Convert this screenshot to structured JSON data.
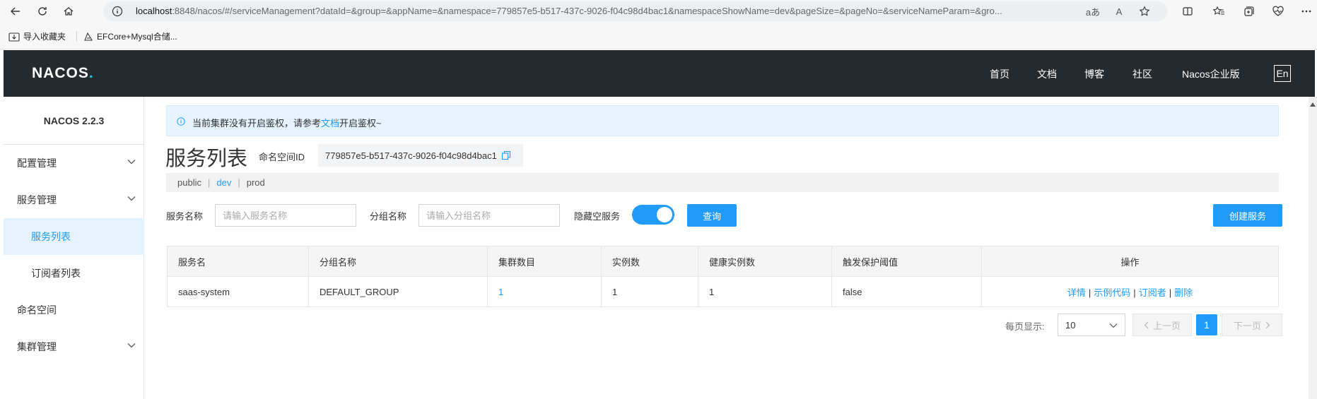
{
  "browser": {
    "url_host": "localhost",
    "url_rest": ":8848/nacos/#/serviceManagement?dataId=&group=&appName=&namespace=779857e5-b517-437c-9026-f04c98d4bac1&namespaceShowName=dev&pageSize=&pageNo=&serviceNameParam=&gro...",
    "read_aloud": "aあ",
    "text_size": "A",
    "bookmarks": [
      {
        "label": "导入收藏夹"
      },
      {
        "label": "EFCore+Mysql合储..."
      }
    ]
  },
  "header": {
    "logo_text": "NACOS",
    "logo_dot": ".",
    "nav": [
      "首页",
      "文档",
      "博客",
      "社区",
      "Nacos企业版"
    ],
    "lang_button": "En"
  },
  "sidebar": {
    "version": "NACOS 2.2.3",
    "items": [
      {
        "label": "配置管理"
      },
      {
        "label": "服务管理"
      },
      {
        "label": "服务列表"
      },
      {
        "label": "订阅者列表"
      },
      {
        "label": "命名空间"
      },
      {
        "label": "集群管理"
      }
    ]
  },
  "notice": {
    "text_before": "当前集群没有开启鉴权，请参考",
    "link": "文档",
    "text_after": "开启鉴权~"
  },
  "page": {
    "title": "服务列表",
    "namespace_label": "命名空间ID",
    "namespace_id": "779857e5-b517-437c-9026-f04c98d4bac1",
    "namespaces": [
      "public",
      "dev",
      "prod"
    ],
    "namespace_separator": "|",
    "current_namespace": "dev"
  },
  "filters": {
    "service_name_label": "服务名称",
    "service_name_placeholder": "请输入服务名称",
    "group_name_label": "分组名称",
    "group_name_placeholder": "请输入分组名称",
    "hide_empty_label": "隐藏空服务",
    "hide_empty_on": true,
    "query_button": "查询",
    "create_button": "创建服务"
  },
  "table": {
    "columns": [
      "服务名",
      "分组名称",
      "集群数目",
      "实例数",
      "健康实例数",
      "触发保护阈值",
      "操作"
    ],
    "rows": [
      {
        "service_name": "saas-system",
        "group": "DEFAULT_GROUP",
        "clusters": "1",
        "instances": "1",
        "healthy": "1",
        "threshold": "false",
        "ops": [
          "详情",
          "示例代码",
          "订阅者",
          "删除"
        ]
      }
    ],
    "ops_separator": "|"
  },
  "pagination": {
    "page_size_label": "每页显示:",
    "page_size": "10",
    "prev": "上一页",
    "current_page": "1",
    "next": "下一页"
  },
  "colors": {
    "accent": "#209bfa",
    "header_bg": "#252a2f",
    "active_bg": "#e4f3fe"
  }
}
